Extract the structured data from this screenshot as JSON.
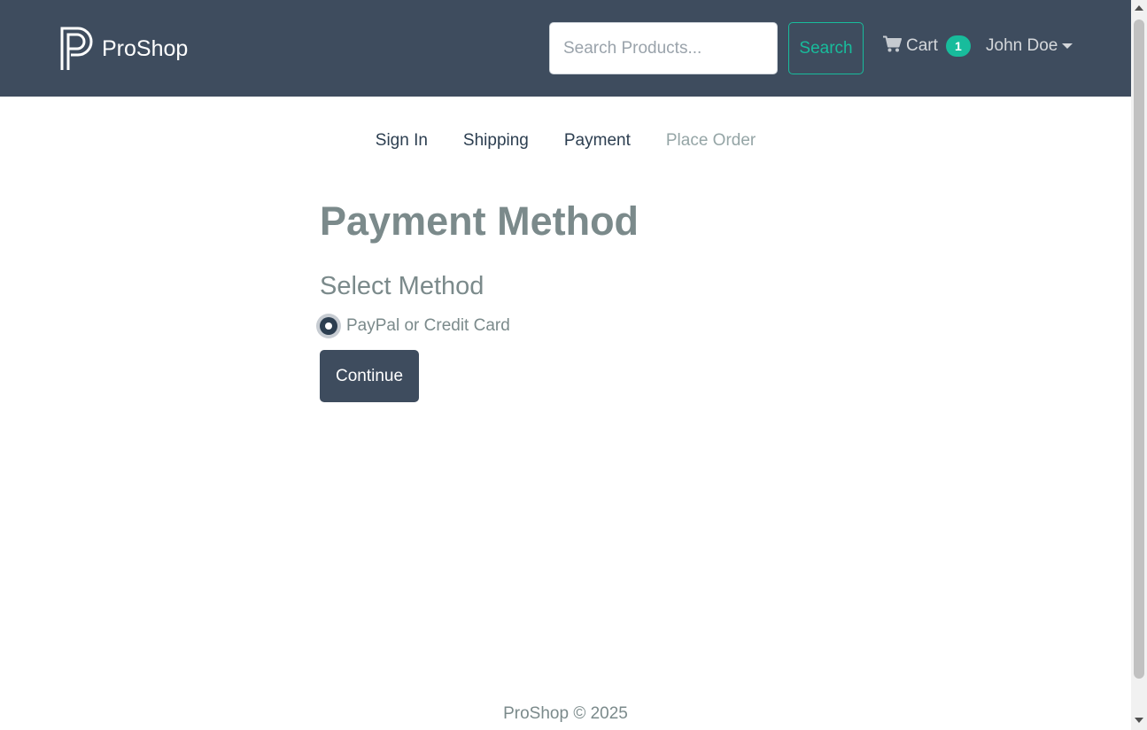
{
  "header": {
    "brand": "ProShop",
    "brand_icon": "proshop-p-logo",
    "search_placeholder": "Search Products...",
    "search_button_label": "Search",
    "cart_label": "Cart",
    "cart_icon": "shopping-cart-icon",
    "cart_count": "1",
    "user_name": "John Doe"
  },
  "checkout_steps": [
    {
      "label": "Sign In",
      "enabled": true
    },
    {
      "label": "Shipping",
      "enabled": true
    },
    {
      "label": "Payment",
      "enabled": true
    },
    {
      "label": "Place Order",
      "enabled": false
    }
  ],
  "main": {
    "title": "Payment Method",
    "select_label": "Select Method",
    "payment_option": {
      "label": "PayPal or Credit Card",
      "checked": true
    },
    "continue_label": "Continue"
  },
  "footer": {
    "text": "ProShop © 2025"
  },
  "colors": {
    "navbar": "#3e4c5e",
    "accent": "#18bc9c",
    "primary_text": "#2c3e50",
    "muted_text": "#7b8a8b",
    "disabled_text": "#95a5a6"
  }
}
